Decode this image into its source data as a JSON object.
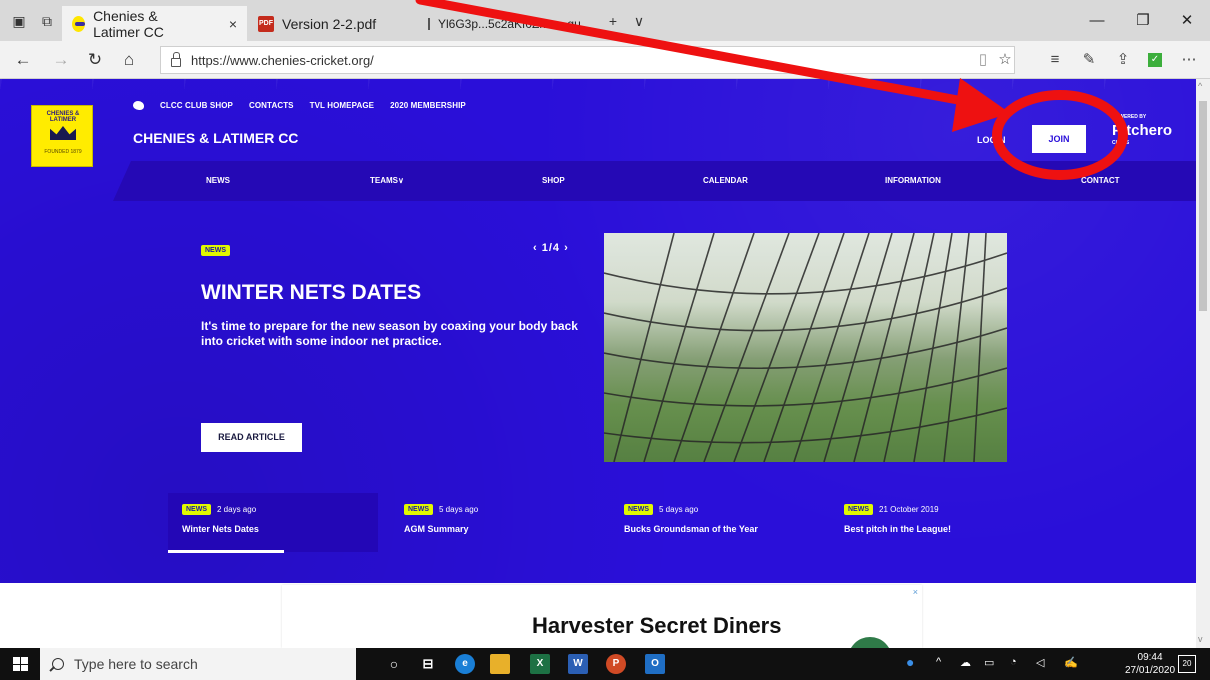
{
  "browser": {
    "tabs": [
      {
        "title": "Chenies & Latimer CC",
        "close": "×"
      },
      {
        "title": "Version 2-2.pdf"
      },
      {
        "title": "Yl6G3p...5c2aKf0Zkwa_gu"
      }
    ],
    "new_tab": "+",
    "tab_menu": "∨",
    "pdf_label": "PDF",
    "url": "https://www.chenies-cricket.org/",
    "window": {
      "minimize": "—",
      "restore": "❐",
      "close": "✕"
    }
  },
  "site": {
    "top_links": [
      "CLCC CLUB SHOP",
      "CONTACTS",
      "TVL HOMEPAGE",
      "2020 MEMBERSHIP"
    ],
    "club_name": "CHENIES & LATIMER CC",
    "logo": {
      "arc": "CHENIES & LATIMER",
      "founded": "FOUNDED 1879"
    },
    "login": "LOGIN",
    "join": "JOIN",
    "powered": {
      "small": "POWERED BY",
      "brand": "Pitchero",
      "tag": "CLUBS"
    },
    "nav": [
      "NEWS",
      "TEAMS∨",
      "SHOP",
      "CALENDAR",
      "INFORMATION",
      "CONTACT"
    ]
  },
  "hero": {
    "badge": "NEWS",
    "pager": "‹ 1/4 ›",
    "title": "WINTER NETS DATES",
    "description": "It's time to prepare for the new season by coaxing your body back into cricket with some indoor net practice.",
    "read_button": "READ ARTICLE"
  },
  "news_strip": [
    {
      "badge": "NEWS",
      "date": "2 days ago",
      "headline": "Winter Nets Dates"
    },
    {
      "badge": "NEWS",
      "date": "5 days ago",
      "headline": "AGM Summary"
    },
    {
      "badge": "NEWS",
      "date": "5 days ago",
      "headline": "Bucks Groundsman of the Year"
    },
    {
      "badge": "NEWS",
      "date": "21 October 2019",
      "headline": "Best pitch in the League!"
    }
  ],
  "ad": {
    "title": "Harvester Secret Diners",
    "close": "×"
  },
  "taskbar": {
    "search_placeholder": "Type here to search",
    "time": "09:44",
    "date": "27/01/2020",
    "notifications": "20"
  },
  "colors": {
    "hero": "#2a0fd9",
    "badge": "#e1f800",
    "annotation": "#ee1111"
  }
}
